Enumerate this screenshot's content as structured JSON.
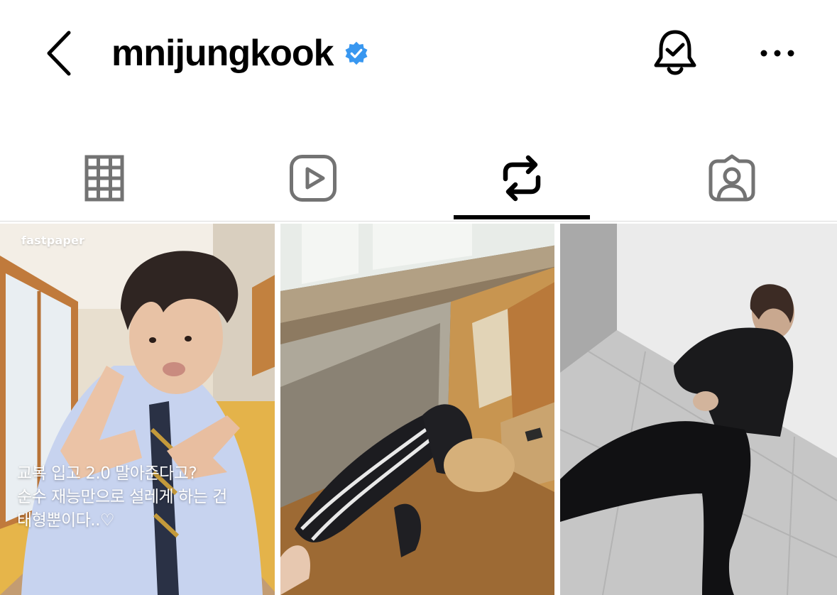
{
  "header": {
    "username": "mnijungkook",
    "verified": true,
    "icons": {
      "back": "chevron-left-icon",
      "verified": "verified-badge-icon",
      "notifications": "bell-check-icon",
      "more": "more-horizontal-icon"
    }
  },
  "tabs": [
    {
      "name": "posts",
      "icon": "grid-icon",
      "active": false
    },
    {
      "name": "reels",
      "icon": "reels-play-icon",
      "active": false
    },
    {
      "name": "reposts",
      "icon": "repost-icon",
      "active": true
    },
    {
      "name": "tagged",
      "icon": "tagged-person-icon",
      "active": false
    }
  ],
  "posts": [
    {
      "watermark": "fastpaper",
      "caption": {
        "line1": "교복 입고 2.0 말아준다고?",
        "line2": "순수 재능만으로 설레게 하는 건",
        "line3": "태형뿐이다..♡"
      }
    },
    {},
    {}
  ],
  "colors": {
    "verified_blue": "#3897f0",
    "icon_gray": "#737373",
    "text": "#000000",
    "divider": "#dbdbdb"
  }
}
